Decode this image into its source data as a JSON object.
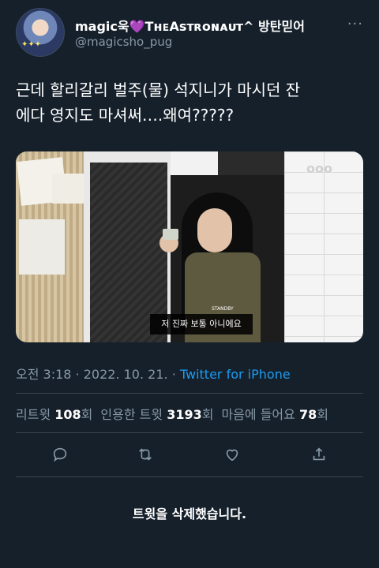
{
  "user": {
    "display_name_part1": "magic욱",
    "heart": "💜",
    "display_name_part2": "TʜᴇAsᴛʀᴏɴᴀᴜᴛ^ 방탄믿어",
    "handle": "@magicsho_pug",
    "more_label": "···"
  },
  "tweet": {
    "line1": "근데 할리갈리 벌주(물) 석지니가 마시던 잔",
    "line2": "에다 영지도 마셔써….왜여?????"
  },
  "media": {
    "watermark": "ooo",
    "subtitle_tag": "STANDBY",
    "subtitle": "저 진짜 보통 아니에요"
  },
  "meta": {
    "time": "오전 3:18",
    "sep1": " · ",
    "date": "2022. 10. 21.",
    "sep2": " · ",
    "source": "Twitter for iPhone"
  },
  "stats": {
    "retweet_label": "리트윗",
    "retweet_count": "108",
    "retweet_unit": "회",
    "quote_label": "인용한 트윗",
    "quote_count": "3193",
    "quote_unit": "회",
    "like_label": "마음에 들어요",
    "like_count": "78",
    "like_unit": "회"
  },
  "actions": {
    "icons": [
      "reply-icon",
      "retweet-icon",
      "like-icon",
      "share-icon"
    ]
  },
  "notice": "트윗을 삭제했습니다.",
  "colors": {
    "background": "#15202b",
    "secondary_text": "#8899a6",
    "link": "#1d9bf0",
    "divider": "#38444d"
  }
}
